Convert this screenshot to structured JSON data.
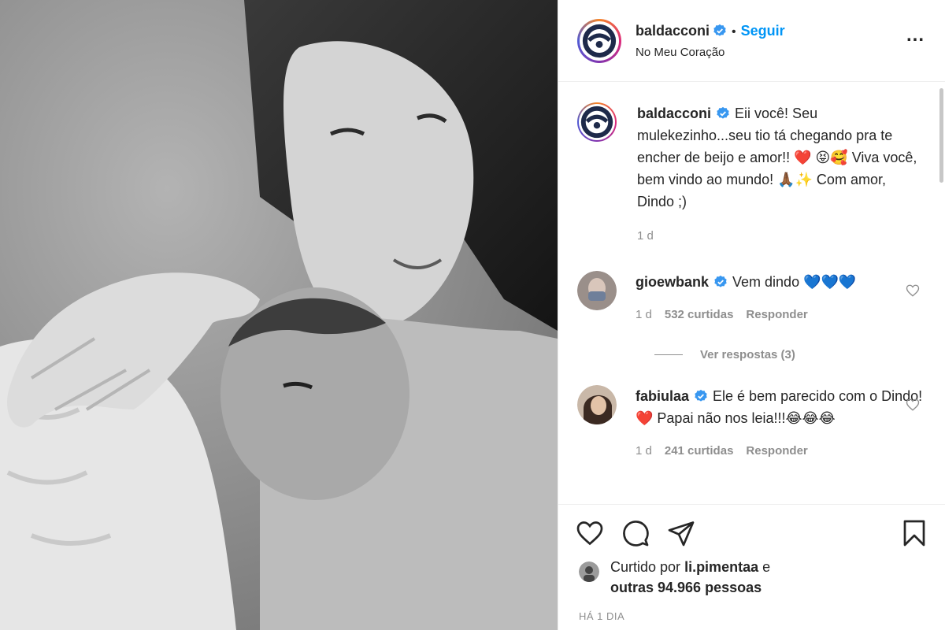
{
  "post": {
    "username": "baldacconi",
    "follow_label": "Seguir",
    "separator": "•",
    "location": "No Meu Coração",
    "more_label": "..."
  },
  "caption": {
    "username": "baldacconi",
    "text": "Eii você! Seu mulekezinho...seu tio tá chegando pra te encher de beijo e amor!! ❤️ 😝🥰 Viva você, bem vindo ao mundo! 🙏🏾✨ Com amor, Dindo ;)",
    "time": "1 d"
  },
  "comments": [
    {
      "username": "gioewbank",
      "text": "Vem dindo 💙💙💙",
      "time": "1 d",
      "likes": "532 curtidas",
      "reply_label": "Responder",
      "view_replies": "Ver respostas (3)"
    },
    {
      "username": "fabiulaa",
      "text": "Ele é bem parecido com o Dindo!❤️ Papai não nos leia!!!😂😂😂",
      "time": "1 d",
      "likes": "241 curtidas",
      "reply_label": "Responder"
    }
  ],
  "likes": {
    "prefix": "Curtido por",
    "user": "li.pimentaa",
    "conj": "e",
    "others": "outras 94.966 pessoas"
  },
  "date_label": "HÁ 1 DIA",
  "colors": {
    "link_blue": "#0095f6",
    "verified_blue": "#3897f0",
    "muted": "#8e8e8e",
    "text": "#262626"
  },
  "icons": [
    "heart-icon",
    "comment-icon",
    "share-icon",
    "bookmark-icon",
    "more-icon",
    "verified-icon"
  ]
}
